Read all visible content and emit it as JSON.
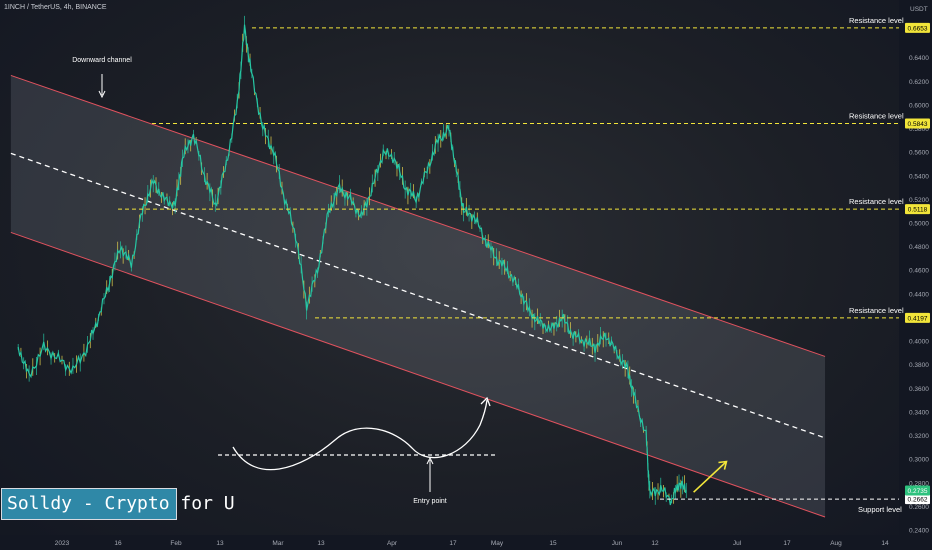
{
  "header": {
    "symbol_line": "1INCH / TetherUS, 4h, BINANCE"
  },
  "watermark": {
    "text": "Solldy - Crypto for U"
  },
  "price_axis": {
    "unit": "USDT"
  },
  "colors": {
    "accent_yellow": "#f2e53a",
    "channel_line": "#e0525e",
    "candle_green": "#26c6a3",
    "candle_yellow": "#e8d44d",
    "badge_green": "#2ec27e"
  },
  "annotations": {
    "downward_channel": "Downward channel",
    "entry_point": "Entry point"
  },
  "chart_data": {
    "type": "line",
    "yaxis": {
      "ticks": [
        0.24,
        0.26,
        0.28,
        0.3,
        0.32,
        0.34,
        0.36,
        0.38,
        0.4,
        0.42,
        0.44,
        0.46,
        0.48,
        0.5,
        0.52,
        0.54,
        0.56,
        0.58,
        0.6,
        0.62,
        0.64
      ],
      "tick_labels": [
        "0.2400",
        "0.2600",
        "0.2800",
        "0.3000",
        "0.3200",
        "0.3400",
        "0.3600",
        "0.3800",
        "0.4000",
        "0.4200",
        "0.4400",
        "0.4600",
        "0.4800",
        "0.5000",
        "0.5200",
        "0.5400",
        "0.5600",
        "0.5800",
        "0.6000",
        "0.6200",
        "0.6400"
      ]
    },
    "xaxis": {
      "tick_labels": [
        "2023",
        "16",
        "Feb",
        "13",
        "Mar",
        "13",
        "Apr",
        "17",
        "May",
        "15",
        "Jun",
        "12",
        "Jul",
        "17",
        "Aug",
        "14"
      ]
    },
    "levels": [
      {
        "name": "Resistance level",
        "value": 0.6653,
        "badge": "0.6653"
      },
      {
        "name": "Resistance level",
        "value": 0.5843,
        "badge": "0.5843"
      },
      {
        "name": "Resistance level",
        "value": 0.5118,
        "badge": "0.5118"
      },
      {
        "name": "Resistance level",
        "value": 0.4197,
        "badge": "0.4197"
      },
      {
        "name": "Support level",
        "value": 0.2662,
        "badge": "0.2662"
      }
    ],
    "current_price": {
      "value": 0.2735,
      "badge": "0.2735"
    },
    "price_path": [
      [
        "2022-12-20",
        0.395
      ],
      [
        "2022-12-23",
        0.37
      ],
      [
        "2022-12-27",
        0.395
      ],
      [
        "2022-12-31",
        0.385
      ],
      [
        "2023-01-04",
        0.375
      ],
      [
        "2023-01-08",
        0.395
      ],
      [
        "2023-01-11",
        0.42
      ],
      [
        "2023-01-14",
        0.45
      ],
      [
        "2023-01-17",
        0.48
      ],
      [
        "2023-01-20",
        0.465
      ],
      [
        "2023-01-23",
        0.51
      ],
      [
        "2023-01-26",
        0.535
      ],
      [
        "2023-01-29",
        0.52
      ],
      [
        "2023-02-01",
        0.515
      ],
      [
        "2023-02-03",
        0.555
      ],
      [
        "2023-02-06",
        0.575
      ],
      [
        "2023-02-09",
        0.54
      ],
      [
        "2023-02-12",
        0.515
      ],
      [
        "2023-02-15",
        0.55
      ],
      [
        "2023-02-18",
        0.6
      ],
      [
        "2023-02-20",
        0.665
      ],
      [
        "2023-02-22",
        0.625
      ],
      [
        "2023-02-25",
        0.58
      ],
      [
        "2023-02-28",
        0.56
      ],
      [
        "2023-03-03",
        0.52
      ],
      [
        "2023-03-06",
        0.49
      ],
      [
        "2023-03-09",
        0.43
      ],
      [
        "2023-03-12",
        0.46
      ],
      [
        "2023-03-15",
        0.51
      ],
      [
        "2023-03-18",
        0.53
      ],
      [
        "2023-03-21",
        0.52
      ],
      [
        "2023-03-24",
        0.505
      ],
      [
        "2023-03-27",
        0.53
      ],
      [
        "2023-03-30",
        0.56
      ],
      [
        "2023-04-02",
        0.555
      ],
      [
        "2023-04-05",
        0.53
      ],
      [
        "2023-04-08",
        0.52
      ],
      [
        "2023-04-11",
        0.545
      ],
      [
        "2023-04-14",
        0.57
      ],
      [
        "2023-04-17",
        0.58
      ],
      [
        "2023-04-19",
        0.545
      ],
      [
        "2023-04-21",
        0.51
      ],
      [
        "2023-04-24",
        0.505
      ],
      [
        "2023-04-27",
        0.485
      ],
      [
        "2023-04-30",
        0.47
      ],
      [
        "2023-05-03",
        0.46
      ],
      [
        "2023-05-06",
        0.445
      ],
      [
        "2023-05-09",
        0.425
      ],
      [
        "2023-05-12",
        0.415
      ],
      [
        "2023-05-15",
        0.41
      ],
      [
        "2023-05-18",
        0.42
      ],
      [
        "2023-05-21",
        0.405
      ],
      [
        "2023-05-24",
        0.4
      ],
      [
        "2023-05-27",
        0.395
      ],
      [
        "2023-05-30",
        0.405
      ],
      [
        "2023-06-02",
        0.39
      ],
      [
        "2023-06-05",
        0.375
      ],
      [
        "2023-06-07",
        0.35
      ],
      [
        "2023-06-10",
        0.32
      ],
      [
        "2023-06-11",
        0.27
      ],
      [
        "2023-06-14",
        0.275
      ],
      [
        "2023-06-17",
        0.265
      ],
      [
        "2023-06-19",
        0.28
      ],
      [
        "2023-06-21",
        0.2735
      ]
    ],
    "channel": {
      "upper": [
        [
          "2022-12-18",
          0.625
        ],
        [
          "2023-07-29",
          0.387
        ]
      ],
      "middle": [
        [
          "2022-12-18",
          0.559
        ],
        [
          "2023-07-29",
          0.318
        ]
      ],
      "lower": [
        [
          "2022-12-18",
          0.492
        ],
        [
          "2023-07-29",
          0.251
        ]
      ]
    },
    "projection_arrow": [
      [
        "2023-06-23",
        0.272
      ],
      [
        "2023-07-02",
        0.298
      ]
    ]
  }
}
